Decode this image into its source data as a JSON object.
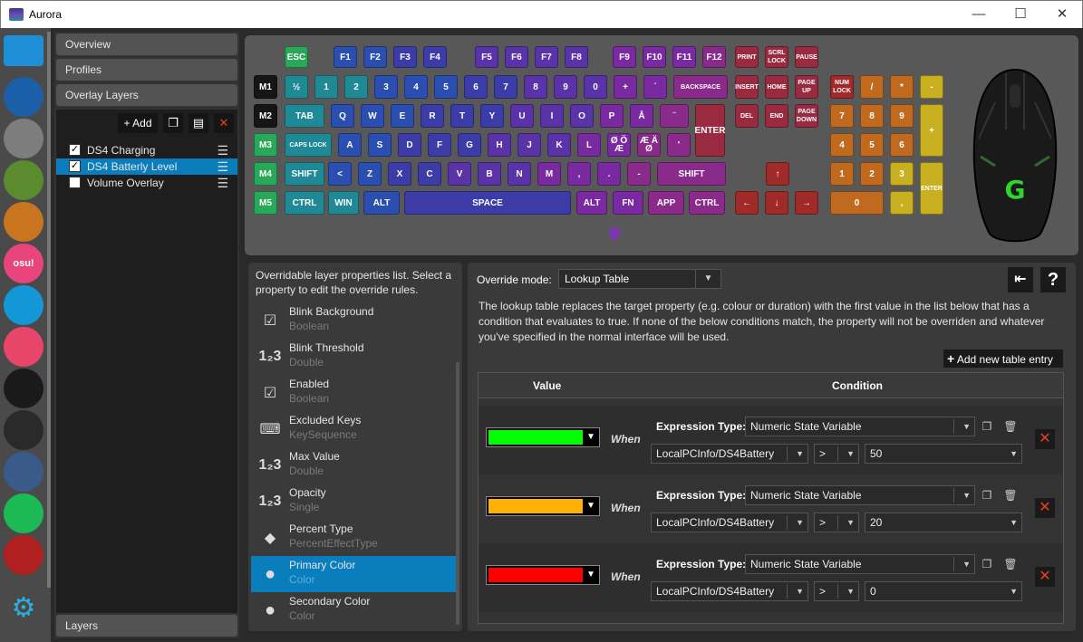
{
  "window": {
    "title": "Aurora",
    "minimize": "—",
    "maximize": "☐",
    "close": "✕"
  },
  "sidebar_apps": [
    {
      "name": "desktop",
      "color": "#1e8fd6"
    },
    {
      "name": "rocket-league",
      "color": "#1a5fa8"
    },
    {
      "name": "overwatch",
      "color": "#7d7d7d"
    },
    {
      "name": "minecraft",
      "color": "#5a8c2f"
    },
    {
      "name": "settings-gear",
      "color": "#c9741f"
    },
    {
      "name": "osu",
      "color": "#e8457d",
      "label": "osu!"
    },
    {
      "name": "skype",
      "color": "#1497d6"
    },
    {
      "name": "slime-rancher",
      "color": "#e8456a"
    },
    {
      "name": "hotline-miami",
      "color": "#1a1a1a"
    },
    {
      "name": "limbo",
      "color": "#2a2a2a"
    },
    {
      "name": "dishonored",
      "color": "#3a5a8a"
    },
    {
      "name": "spotify",
      "color": "#1db954"
    },
    {
      "name": "red-game",
      "color": "#b02020"
    }
  ],
  "layer_panel": {
    "overview": "Overview",
    "profiles": "Profiles",
    "overlay_layers": "Overlay Layers",
    "add_label": "+ Add",
    "layers": [
      {
        "name": "DS4 Charging",
        "checked": true,
        "selected": false
      },
      {
        "name": "DS4 Batterly Level",
        "checked": true,
        "selected": true
      },
      {
        "name": "Volume Overlay",
        "checked": false,
        "selected": false
      }
    ],
    "layers_footer": "Layers"
  },
  "keyboard": {
    "colors": {
      "green": "#2aa85a",
      "teal": "#1f8a96",
      "blue": "#2a4fb0",
      "indigo": "#3b3ca8",
      "violet": "#5a33a8",
      "purple": "#7a2aa0",
      "magenta": "#8a2a8a",
      "red": "#9a2a40",
      "darkred": "#a02a2a",
      "orange": "#c06a20",
      "yellow": "#c8b020",
      "gkey": "#1a6a2a"
    },
    "row1": [
      "ESC",
      "F1",
      "F2",
      "F3",
      "F4",
      "F5",
      "F6",
      "F7",
      "F8",
      "F9",
      "F10",
      "F11",
      "F12",
      "PRINT",
      "SCRL LOCK",
      "PAUSE"
    ],
    "row2": [
      "½",
      "1",
      "2",
      "3",
      "4",
      "5",
      "6",
      "7",
      "8",
      "9",
      "0",
      "+",
      "´",
      "BACKSPACE",
      "INSERT",
      "HOME",
      "PAGE UP",
      "NUM LOCK",
      "/",
      "*",
      "-"
    ],
    "row3": [
      "TAB",
      "Q",
      "W",
      "E",
      "R",
      "T",
      "Y",
      "U",
      "I",
      "O",
      "P",
      "Å",
      "¨",
      "ENTER",
      "DEL",
      "END",
      "PAGE DOWN",
      "7",
      "8",
      "9",
      "+"
    ],
    "row4": [
      "CAPS LOCK",
      "A",
      "S",
      "D",
      "F",
      "G",
      "H",
      "J",
      "K",
      "L",
      "Ø Ö Æ",
      "Æ Ä Ø",
      "'",
      "4",
      "5",
      "6"
    ],
    "row5": [
      "SHIFT",
      "<",
      "Z",
      "X",
      "C",
      "V",
      "B",
      "N",
      "M",
      ",",
      ".",
      "-",
      "SHIFT",
      "↑",
      "1",
      "2",
      "3",
      "ENTER"
    ],
    "row6": [
      "CTRL",
      "WIN",
      "ALT",
      "SPACE",
      "ALT",
      "FN",
      "APP",
      "CTRL",
      "←",
      "↓",
      "→",
      "0",
      ","
    ],
    "macro": [
      "M1",
      "M2",
      "M3",
      "M4",
      "M5"
    ]
  },
  "properties": {
    "intro": "Overridable layer properties list. Select a property to edit the override rules.",
    "items": [
      {
        "name": "Blink Background",
        "type": "Boolean",
        "icon": "checkbox-icon"
      },
      {
        "name": "Blink Threshold",
        "type": "Double",
        "icon": "number-icon"
      },
      {
        "name": "Enabled",
        "type": "Boolean",
        "icon": "checkbox-icon"
      },
      {
        "name": "Excluded Keys",
        "type": "KeySequence",
        "icon": "keyboard-icon"
      },
      {
        "name": "Max Value",
        "type": "Double",
        "icon": "number-icon"
      },
      {
        "name": "Opacity",
        "type": "Single",
        "icon": "number-icon"
      },
      {
        "name": "Percent Type",
        "type": "PercentEffectType",
        "icon": "diamond-icon"
      },
      {
        "name": "Primary Color",
        "type": "Color",
        "icon": "palette-icon"
      },
      {
        "name": "Secondary Color",
        "type": "Color",
        "icon": "palette-icon"
      }
    ]
  },
  "override": {
    "mode_label": "Override mode:",
    "mode_value": "Lookup Table",
    "help": "?",
    "description": "The lookup table replaces the target property (e.g. colour or duration) with the first value in the list below that has a condition that evaluates to true. If none of the below conditions match, the property will not be overriden and whatever you've specified in the normal interface will be used.",
    "add_entry": "Add new table entry",
    "col_value": "Value",
    "col_condition": "Condition",
    "when": "When",
    "expr_label": "Expression Type:",
    "entries": [
      {
        "color": "#00ff00",
        "expr": "Numeric State Variable",
        "variable": "LocalPCInfo/DS4Battery",
        "op": ">",
        "value": "50"
      },
      {
        "color": "#ffb000",
        "expr": "Numeric State Variable",
        "variable": "LocalPCInfo/DS4Battery",
        "op": ">",
        "value": "20"
      },
      {
        "color": "#ff0000",
        "expr": "Numeric State Variable",
        "variable": "LocalPCInfo/DS4Battery",
        "op": ">",
        "value": "0"
      }
    ]
  }
}
